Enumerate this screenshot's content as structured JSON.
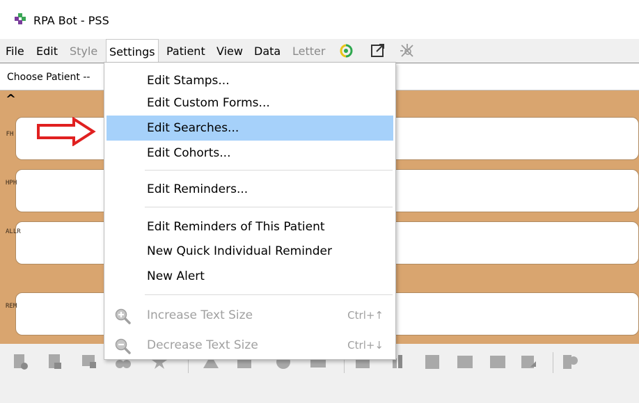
{
  "window": {
    "title": "RPA Bot - PSS",
    "app_icon": "clover-icon"
  },
  "menubar": {
    "items": [
      {
        "label": "File",
        "disabled": false
      },
      {
        "label": "Edit",
        "disabled": false
      },
      {
        "label": "Style",
        "disabled": true
      },
      {
        "label": "Settings",
        "disabled": false,
        "open": true
      },
      {
        "label": "Patient",
        "disabled": false
      },
      {
        "label": "View",
        "disabled": false
      },
      {
        "label": "Data",
        "disabled": false
      },
      {
        "label": "Letter",
        "disabled": true
      }
    ],
    "icons": [
      "signal-icon",
      "external-window-icon",
      "satellite-icon"
    ]
  },
  "patient_select": {
    "value": "Choose Patient --"
  },
  "side_labels": [
    "FH",
    "HPH",
    "ALLR",
    "REM"
  ],
  "settings_menu": {
    "items": [
      {
        "label": "Edit Stamps..."
      },
      {
        "label": "Edit Custom Forms..."
      },
      {
        "label": "Edit Searches...",
        "highlighted": true
      },
      {
        "label": "Edit Cohorts..."
      },
      {
        "label": "Edit Reminders..."
      },
      {
        "label": "Edit Reminders of This Patient"
      },
      {
        "label": "New Quick Individual Reminder"
      },
      {
        "label": "New Alert"
      },
      {
        "label": "Increase Text Size",
        "shortcut": "Ctrl+↑",
        "disabled": true,
        "icon": "zoom-in-icon"
      },
      {
        "label": "Decrease Text Size",
        "shortcut": "Ctrl+↓",
        "disabled": true,
        "icon": "zoom-out-icon"
      }
    ]
  },
  "annotation": {
    "icon": "red-arrow-icon",
    "color": "#e02020"
  },
  "colors": {
    "panel_background": "#d9a56f",
    "highlight": "#a6d1fa",
    "disabled_text": "#a0a0a0"
  }
}
